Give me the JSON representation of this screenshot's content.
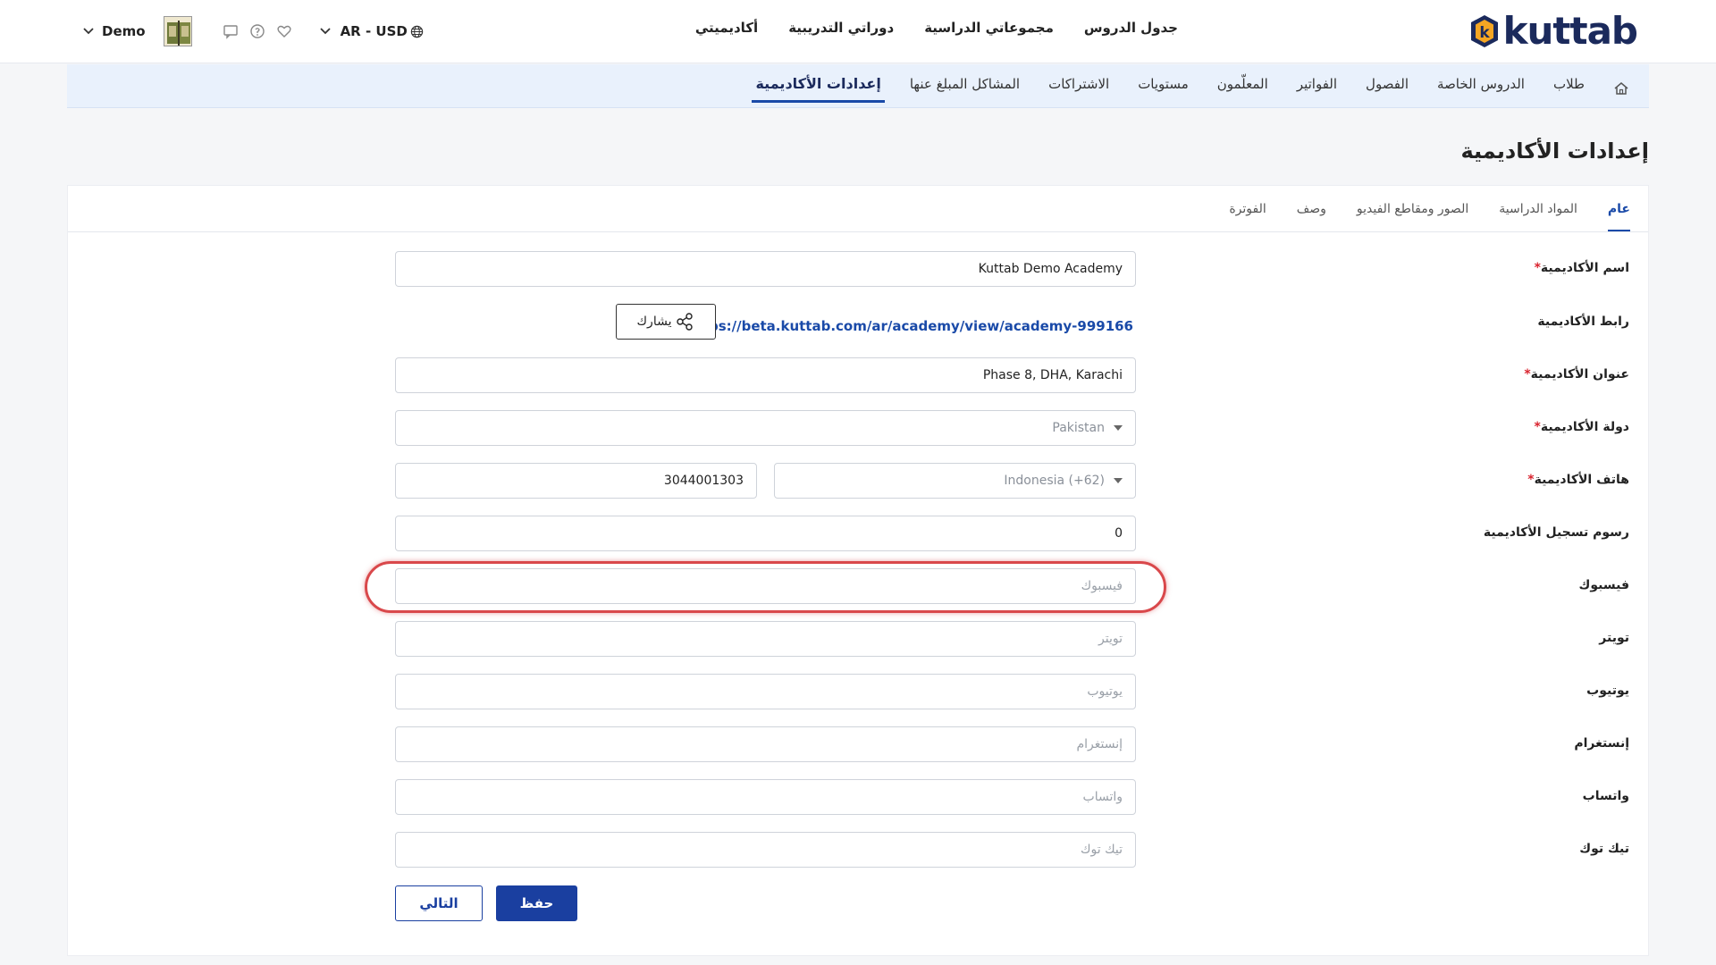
{
  "header": {
    "logo_text": "kuttab",
    "logo_letter": "k",
    "nav": [
      "جدول الدروس",
      "مجموعاتي الدراسية",
      "دوراتي التدريبية",
      "أكاديميتي"
    ],
    "lang_currency": "AR - USD",
    "user_name": "Demo"
  },
  "subnav": {
    "items": [
      "طلاب",
      "الدروس الخاصة",
      "الفصول",
      "الفواتير",
      "المعلّمون",
      "مستويات",
      "الاشتراكات",
      "المشاكل المبلغ عنها",
      "إعدادات الأكاديمية"
    ],
    "active_index": 8
  },
  "page": {
    "title": "إعدادات الأكاديمية"
  },
  "tabs": {
    "items": [
      "عام",
      "المواد الدراسية",
      "الصور ومقاطع الفيديو",
      "وصف",
      "الفوترة"
    ],
    "active_index": 0
  },
  "form": {
    "name_label": "اسم الأكاديمية",
    "name_value": "Kuttab Demo Academy",
    "link_label": "رابط الأكاديمية",
    "link_url": "https://beta.kuttab.com/ar/academy/view/academy-999166",
    "share_label": "يشارك",
    "address_label": "عنوان الأكاديمية",
    "address_value": "Phase 8, DHA, Karachi",
    "country_label": "دولة الأكاديمية",
    "country_value": "Pakistan",
    "phone_label": "هاتف الأكاديمية",
    "phone_code": "Indonesia (+62)",
    "phone_value": "3044001303",
    "fee_label": "رسوم تسجيل الأكاديمية",
    "fee_value": "0",
    "facebook_label": "فيسبوك",
    "facebook_placeholder": "فيسبوك",
    "twitter_label": "تويتر",
    "twitter_placeholder": "تويتر",
    "youtube_label": "يوتيوب",
    "youtube_placeholder": "يوتيوب",
    "instagram_label": "إنستغرام",
    "instagram_placeholder": "إنستغرام",
    "whatsapp_label": "واتساب",
    "whatsapp_placeholder": "واتساب",
    "tiktok_label": "تيك توك",
    "tiktok_placeholder": "تيك توك",
    "required_mark": "*"
  },
  "buttons": {
    "save": "حفظ",
    "next": "التالي"
  },
  "colors": {
    "primary": "#1a3fa0",
    "highlight": "#d9484b",
    "subnav_bg": "#e9f1fc"
  }
}
